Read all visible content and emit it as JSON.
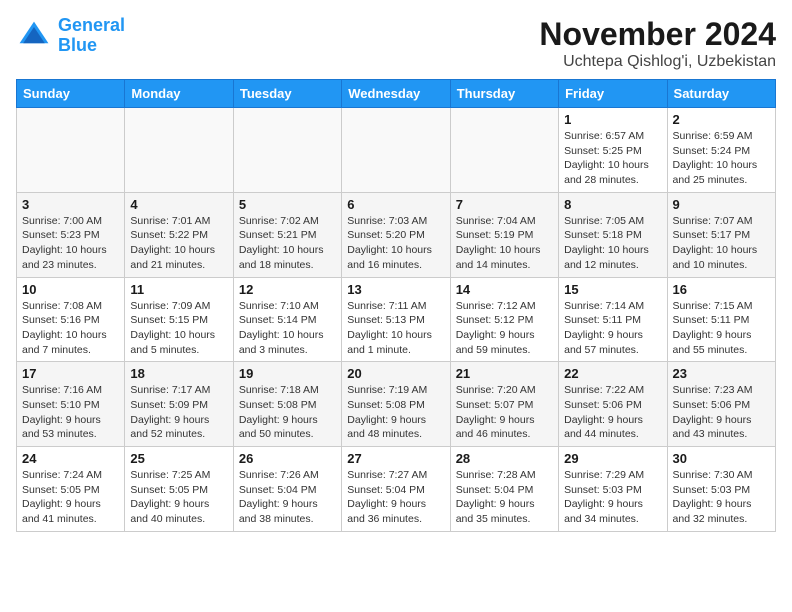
{
  "header": {
    "logo_line1": "General",
    "logo_line2": "Blue",
    "month": "November 2024",
    "location": "Uchtepa Qishlog'i, Uzbekistan"
  },
  "weekdays": [
    "Sunday",
    "Monday",
    "Tuesday",
    "Wednesday",
    "Thursday",
    "Friday",
    "Saturday"
  ],
  "weeks": [
    [
      {
        "day": "",
        "info": ""
      },
      {
        "day": "",
        "info": ""
      },
      {
        "day": "",
        "info": ""
      },
      {
        "day": "",
        "info": ""
      },
      {
        "day": "",
        "info": ""
      },
      {
        "day": "1",
        "info": "Sunrise: 6:57 AM\nSunset: 5:25 PM\nDaylight: 10 hours and 28 minutes."
      },
      {
        "day": "2",
        "info": "Sunrise: 6:59 AM\nSunset: 5:24 PM\nDaylight: 10 hours and 25 minutes."
      }
    ],
    [
      {
        "day": "3",
        "info": "Sunrise: 7:00 AM\nSunset: 5:23 PM\nDaylight: 10 hours and 23 minutes."
      },
      {
        "day": "4",
        "info": "Sunrise: 7:01 AM\nSunset: 5:22 PM\nDaylight: 10 hours and 21 minutes."
      },
      {
        "day": "5",
        "info": "Sunrise: 7:02 AM\nSunset: 5:21 PM\nDaylight: 10 hours and 18 minutes."
      },
      {
        "day": "6",
        "info": "Sunrise: 7:03 AM\nSunset: 5:20 PM\nDaylight: 10 hours and 16 minutes."
      },
      {
        "day": "7",
        "info": "Sunrise: 7:04 AM\nSunset: 5:19 PM\nDaylight: 10 hours and 14 minutes."
      },
      {
        "day": "8",
        "info": "Sunrise: 7:05 AM\nSunset: 5:18 PM\nDaylight: 10 hours and 12 minutes."
      },
      {
        "day": "9",
        "info": "Sunrise: 7:07 AM\nSunset: 5:17 PM\nDaylight: 10 hours and 10 minutes."
      }
    ],
    [
      {
        "day": "10",
        "info": "Sunrise: 7:08 AM\nSunset: 5:16 PM\nDaylight: 10 hours and 7 minutes."
      },
      {
        "day": "11",
        "info": "Sunrise: 7:09 AM\nSunset: 5:15 PM\nDaylight: 10 hours and 5 minutes."
      },
      {
        "day": "12",
        "info": "Sunrise: 7:10 AM\nSunset: 5:14 PM\nDaylight: 10 hours and 3 minutes."
      },
      {
        "day": "13",
        "info": "Sunrise: 7:11 AM\nSunset: 5:13 PM\nDaylight: 10 hours and 1 minute."
      },
      {
        "day": "14",
        "info": "Sunrise: 7:12 AM\nSunset: 5:12 PM\nDaylight: 9 hours and 59 minutes."
      },
      {
        "day": "15",
        "info": "Sunrise: 7:14 AM\nSunset: 5:11 PM\nDaylight: 9 hours and 57 minutes."
      },
      {
        "day": "16",
        "info": "Sunrise: 7:15 AM\nSunset: 5:11 PM\nDaylight: 9 hours and 55 minutes."
      }
    ],
    [
      {
        "day": "17",
        "info": "Sunrise: 7:16 AM\nSunset: 5:10 PM\nDaylight: 9 hours and 53 minutes."
      },
      {
        "day": "18",
        "info": "Sunrise: 7:17 AM\nSunset: 5:09 PM\nDaylight: 9 hours and 52 minutes."
      },
      {
        "day": "19",
        "info": "Sunrise: 7:18 AM\nSunset: 5:08 PM\nDaylight: 9 hours and 50 minutes."
      },
      {
        "day": "20",
        "info": "Sunrise: 7:19 AM\nSunset: 5:08 PM\nDaylight: 9 hours and 48 minutes."
      },
      {
        "day": "21",
        "info": "Sunrise: 7:20 AM\nSunset: 5:07 PM\nDaylight: 9 hours and 46 minutes."
      },
      {
        "day": "22",
        "info": "Sunrise: 7:22 AM\nSunset: 5:06 PM\nDaylight: 9 hours and 44 minutes."
      },
      {
        "day": "23",
        "info": "Sunrise: 7:23 AM\nSunset: 5:06 PM\nDaylight: 9 hours and 43 minutes."
      }
    ],
    [
      {
        "day": "24",
        "info": "Sunrise: 7:24 AM\nSunset: 5:05 PM\nDaylight: 9 hours and 41 minutes."
      },
      {
        "day": "25",
        "info": "Sunrise: 7:25 AM\nSunset: 5:05 PM\nDaylight: 9 hours and 40 minutes."
      },
      {
        "day": "26",
        "info": "Sunrise: 7:26 AM\nSunset: 5:04 PM\nDaylight: 9 hours and 38 minutes."
      },
      {
        "day": "27",
        "info": "Sunrise: 7:27 AM\nSunset: 5:04 PM\nDaylight: 9 hours and 36 minutes."
      },
      {
        "day": "28",
        "info": "Sunrise: 7:28 AM\nSunset: 5:04 PM\nDaylight: 9 hours and 35 minutes."
      },
      {
        "day": "29",
        "info": "Sunrise: 7:29 AM\nSunset: 5:03 PM\nDaylight: 9 hours and 34 minutes."
      },
      {
        "day": "30",
        "info": "Sunrise: 7:30 AM\nSunset: 5:03 PM\nDaylight: 9 hours and 32 minutes."
      }
    ]
  ]
}
